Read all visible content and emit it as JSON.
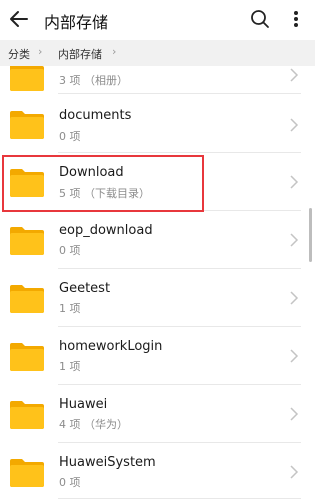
{
  "appbar": {
    "title": "内部存储"
  },
  "breadcrumb": {
    "items": [
      "分类",
      "内部存储"
    ],
    "separator": "›"
  },
  "list": [
    {
      "meta": "3 项 （相册）"
    },
    {
      "name": "documents",
      "meta": "0 项"
    },
    {
      "name": "Download",
      "meta": "5 项 （下载目录）"
    },
    {
      "name": "eop_download",
      "meta": "0 项"
    },
    {
      "name": "Geetest",
      "meta": "1 项"
    },
    {
      "name": "homeworkLogin",
      "meta": "1 项"
    },
    {
      "name": "Huawei",
      "meta": "4 项 （华为）"
    },
    {
      "name": "HuaweiSystem",
      "meta": "0 项"
    }
  ],
  "colors": {
    "folder": "#FFC21A",
    "folder_tab": "#F3A900",
    "highlight": "#E8373C"
  },
  "icons": {
    "back": "arrow-left-icon",
    "search": "search-icon",
    "more": "more-vertical-icon",
    "folder": "folder-icon",
    "chevron": "chevron-right-icon"
  }
}
